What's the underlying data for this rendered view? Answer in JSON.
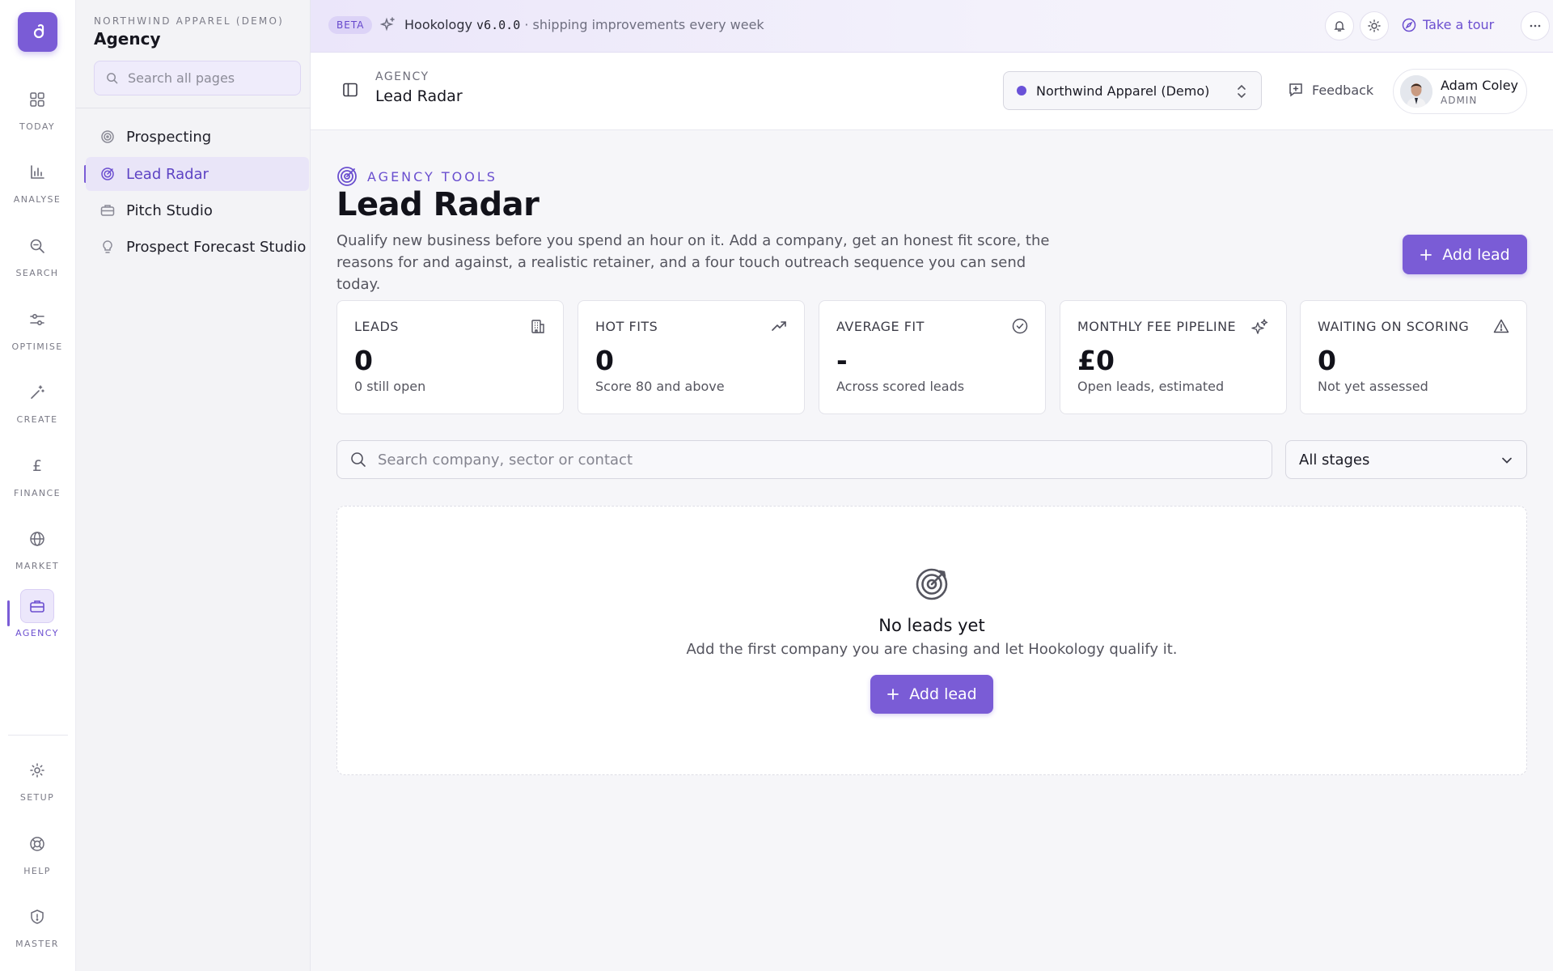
{
  "rail": {
    "items": [
      {
        "label": "TODAY",
        "icon": "grid-icon"
      },
      {
        "label": "ANALYSE",
        "icon": "bar-chart-icon"
      },
      {
        "label": "SEARCH",
        "icon": "search-icon"
      },
      {
        "label": "OPTIMISE",
        "icon": "sliders-icon"
      },
      {
        "label": "CREATE",
        "icon": "magic-wand-icon"
      },
      {
        "label": "FINANCE",
        "icon": "pound-icon"
      },
      {
        "label": "MARKET",
        "icon": "globe-icon"
      },
      {
        "label": "AGENCY",
        "icon": "briefcase-icon",
        "active": true
      },
      {
        "label": "SETUP",
        "icon": "gear-icon"
      },
      {
        "label": "HELP",
        "icon": "lifebuoy-icon"
      },
      {
        "label": "MASTER",
        "icon": "shield-icon"
      }
    ]
  },
  "sidebar": {
    "org": "NORTHWIND APPAREL (DEMO)",
    "title": "Agency",
    "search_placeholder": "Search all pages",
    "items": [
      {
        "label": "Prospecting",
        "icon": "target-icon"
      },
      {
        "label": "Lead Radar",
        "icon": "radar-icon",
        "active": true
      },
      {
        "label": "Pitch Studio",
        "icon": "briefcase-icon"
      },
      {
        "label": "Prospect Forecast Studio",
        "icon": "lightbulb-icon"
      }
    ]
  },
  "banner": {
    "badge": "BETA",
    "app": "Hookology",
    "version": "v6.0.0",
    "tagline": "· shipping improvements every week",
    "tour_label": "Take a tour"
  },
  "header": {
    "crumb": "AGENCY",
    "title": "Lead Radar",
    "org_select": "Northwind Apparel (Demo)",
    "feedback_label": "Feedback",
    "user_name": "Adam Coley",
    "user_role": "ADMIN"
  },
  "page": {
    "eyebrow": "AGENCY TOOLS",
    "title": "Lead Radar",
    "description": "Qualify new business before you spend an hour on it. Add a company, get an honest fit score, the reasons for and against, a realistic retainer, and a four touch outreach sequence you can send today.",
    "add_lead_label": "Add lead"
  },
  "stats": [
    {
      "label": "LEADS",
      "value": "0",
      "sub": "0 still open",
      "icon": "building-icon"
    },
    {
      "label": "HOT FITS",
      "value": "0",
      "sub": "Score 80 and above",
      "icon": "trending-up-icon"
    },
    {
      "label": "AVERAGE FIT",
      "value": "-",
      "sub": "Across scored leads",
      "icon": "check-circle-icon"
    },
    {
      "label": "MONTHLY FEE PIPELINE",
      "value": "£0",
      "sub": "Open leads, estimated",
      "icon": "sparkles-icon"
    },
    {
      "label": "WAITING ON SCORING",
      "value": "0",
      "sub": "Not yet assessed",
      "icon": "warning-icon"
    }
  ],
  "filters": {
    "search_placeholder": "Search company, sector or contact",
    "stage_selected": "All stages"
  },
  "empty_state": {
    "title": "No leads yet",
    "subtitle": "Add the first company you are chasing and let Hookology qualify it.",
    "button_label": "Add lead"
  },
  "colors": {
    "accent": "#7a5cd6",
    "accent_text": "#6a4fcf",
    "org_dot": "#6a52d8"
  }
}
